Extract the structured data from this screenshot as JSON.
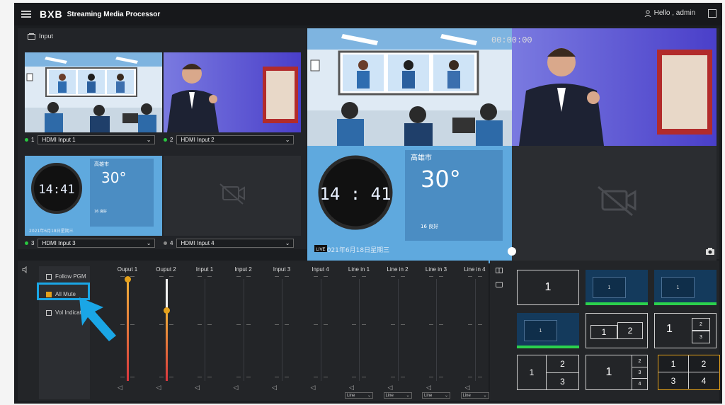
{
  "header": {
    "logo": "BXB",
    "title": "Streaming Media Processor",
    "greeting": "Hello , admin"
  },
  "input_panel": {
    "title": "Input",
    "sources": [
      {
        "num": "1",
        "label": "HDMI Input 1",
        "active": true
      },
      {
        "num": "2",
        "label": "HDMI Input 2",
        "active": true
      },
      {
        "num": "3",
        "label": "HDMI Input 3",
        "active": true
      },
      {
        "num": "4",
        "label": "HDMI Input 4",
        "active": false
      }
    ]
  },
  "widget": {
    "time": "14:41",
    "time_large": "14 : 41",
    "city": "高雄市",
    "temp": "30°",
    "date": "2021年6月18日星期三",
    "air": "16 良好"
  },
  "preview": {
    "timecode": "00:00:00",
    "live_badge": "LIVE"
  },
  "audio": {
    "options": [
      {
        "label": "Follow PGM",
        "checked": false
      },
      {
        "label": "All Mute",
        "checked": true
      },
      {
        "label": "Vol Indicator",
        "checked": false
      }
    ],
    "channels": [
      "Ouput 1",
      "Ouput 2",
      "Input 1",
      "Input 2",
      "Input 3",
      "Input 4",
      "Line in 1",
      "Line in 2",
      "Line in 3",
      "Line in 4"
    ],
    "line_select": "Line"
  },
  "layouts": [
    {
      "nums": [
        "1"
      ]
    },
    {
      "nums": [
        "1"
      ]
    },
    {
      "nums": [
        "1"
      ]
    },
    {
      "nums": [
        "1"
      ]
    },
    {
      "nums": [
        "1",
        "2"
      ]
    },
    {
      "nums": [
        "1",
        "2",
        "3"
      ]
    },
    {
      "nums": [
        "1",
        "2",
        "3"
      ]
    },
    {
      "nums": [
        "1",
        "2",
        "3",
        "4"
      ]
    },
    {
      "nums": [
        "1",
        "2",
        "3",
        "4"
      ]
    }
  ],
  "colors": {
    "accent": "#e4a11b",
    "highlight": "#1aa6e6",
    "active_dot": "#28c840",
    "fader_red": "#d9363e"
  }
}
